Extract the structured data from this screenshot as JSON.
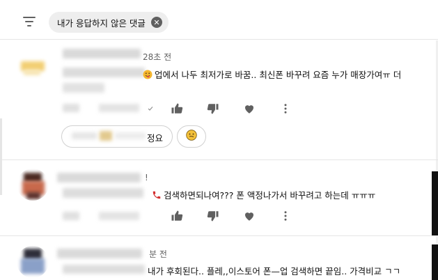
{
  "filter": {
    "chip_label": "내가 응답하지 않은 댓글",
    "close_glyph": "✕"
  },
  "comments": [
    {
      "time": "28초 전",
      "text": "업에서 나두 최저가로 바꿈.. 최신폰 바꾸려 요즘 누가 매장가여ㅠ 더",
      "reply_suffix": "정요",
      "leading_emoji": "face-with-tongue",
      "avatar_colors": [
        "#f3d27a",
        "#f7e3a8"
      ]
    },
    {
      "time": "!",
      "text": "검색하면되나여??? 폰 액정나가서 바꾸려고 하는데 ㅠㅠㅠ",
      "leading_emoji": "telephone-receiver",
      "avatar_colors": [
        "#7a3b2e",
        "#c76a4f"
      ]
    },
    {
      "time": "분 전",
      "text": "내가 후회된다.. 플레,,이스토어 폰—업 검색하면 끝임.. 가격비교 ㄱㄱ",
      "avatar_colors": [
        "#3b3b4a",
        "#8fa3c7"
      ]
    }
  ],
  "colors": {
    "icon_gray": "#606060",
    "chip_bg": "#eeeeee",
    "divider": "#e5e5e5"
  }
}
